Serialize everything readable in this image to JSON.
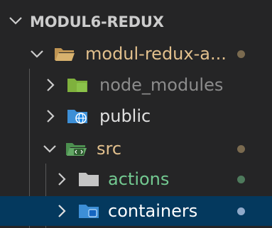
{
  "explorer": {
    "section_title": "MODUL6-REDUX",
    "items": [
      {
        "label": "modul-redux-a...",
        "icon": "folder-open-icon",
        "expanded": true,
        "status_color": "#7a6a4f"
      },
      {
        "label": "node_modules",
        "icon": "folder-node-icon",
        "expanded": false
      },
      {
        "label": "public",
        "icon": "folder-public-icon",
        "expanded": false
      },
      {
        "label": "src",
        "icon": "folder-src-icon",
        "expanded": true,
        "status_color": "#7a6a4f"
      },
      {
        "label": "actions",
        "icon": "folder-icon",
        "expanded": false,
        "status_color": "#4e7a5c"
      },
      {
        "label": "containers",
        "icon": "folder-containers-icon",
        "expanded": false,
        "selected": true,
        "status_color": "#8fa9c9"
      }
    ]
  },
  "colors": {
    "background": "#252526",
    "selection": "#04395e",
    "modified_text": "#e2c08d",
    "untracked_text": "#73c991",
    "ignored_text": "#8c8c8c"
  }
}
